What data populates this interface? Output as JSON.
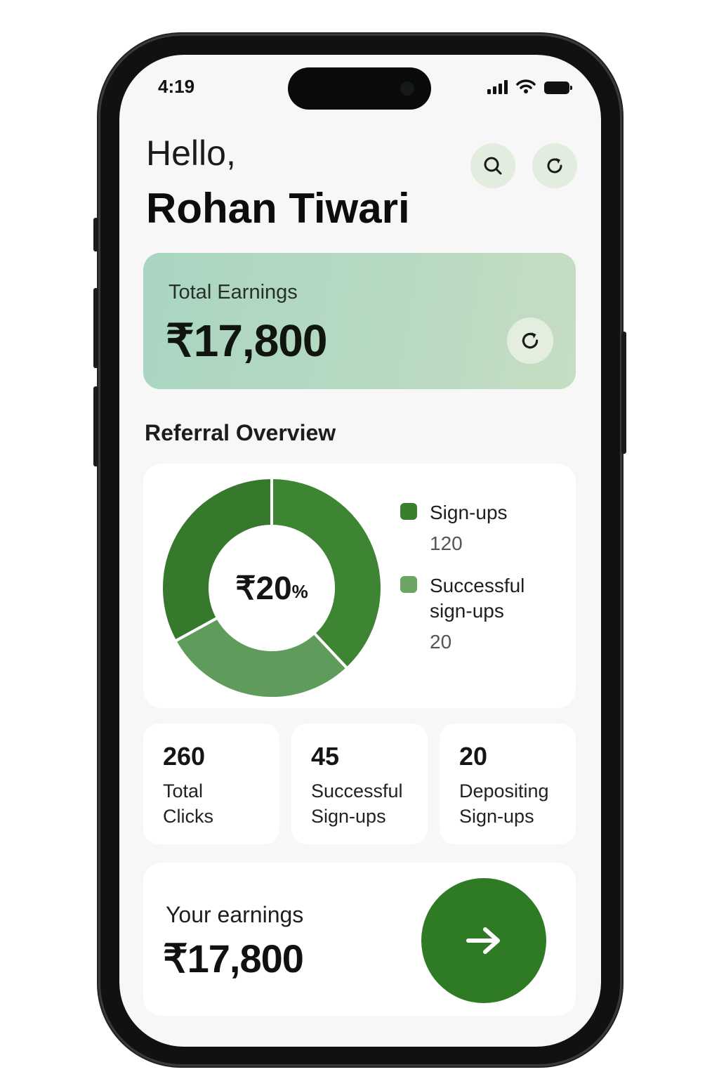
{
  "status_bar": {
    "time": "4:19"
  },
  "header": {
    "greeting": "Hello,",
    "user_name": "Rohan Tiwari",
    "search_icon": "search-icon",
    "refresh_icon": "refresh-icon"
  },
  "earnings_card": {
    "label": "Total Earnings",
    "value": "₹17,800",
    "refresh_icon": "refresh-icon"
  },
  "referral_overview": {
    "title": "Referral Overview",
    "center_value": "₹20",
    "center_unit": "%",
    "legend": [
      {
        "label": "Sign-ups",
        "value": "120",
        "color": "#3a7f2e"
      },
      {
        "label": "Successful sign-ups",
        "value": "20",
        "color": "#6aa563"
      }
    ]
  },
  "chart_data": {
    "type": "pie",
    "style": "donut",
    "center_label": "₹20%",
    "segments": [
      {
        "share": 0.38,
        "color": "#3d8433"
      },
      {
        "share": 0.29,
        "color": "#5f9b5a"
      },
      {
        "share": 0.33,
        "color": "#37792c"
      }
    ],
    "legend": [
      {
        "label": "Sign-ups",
        "value": 120
      },
      {
        "label": "Successful sign-ups",
        "value": 20
      }
    ],
    "legend_position": "right"
  },
  "stats": [
    {
      "value": "260",
      "label": "Total Clicks"
    },
    {
      "value": "45",
      "label": "Successful Sign-ups"
    },
    {
      "value": "20",
      "label": "Depositing Sign-ups"
    }
  ],
  "your_earnings": {
    "label": "Your earnings",
    "value": "₹17,800",
    "button_icon": "arrow-right-icon"
  },
  "colors": {
    "accent": "#2f7a25",
    "card_gradient_start": "#a9d5c1",
    "card_gradient_end": "#c6ddc2",
    "icon_button_bg": "#e2ede0"
  }
}
